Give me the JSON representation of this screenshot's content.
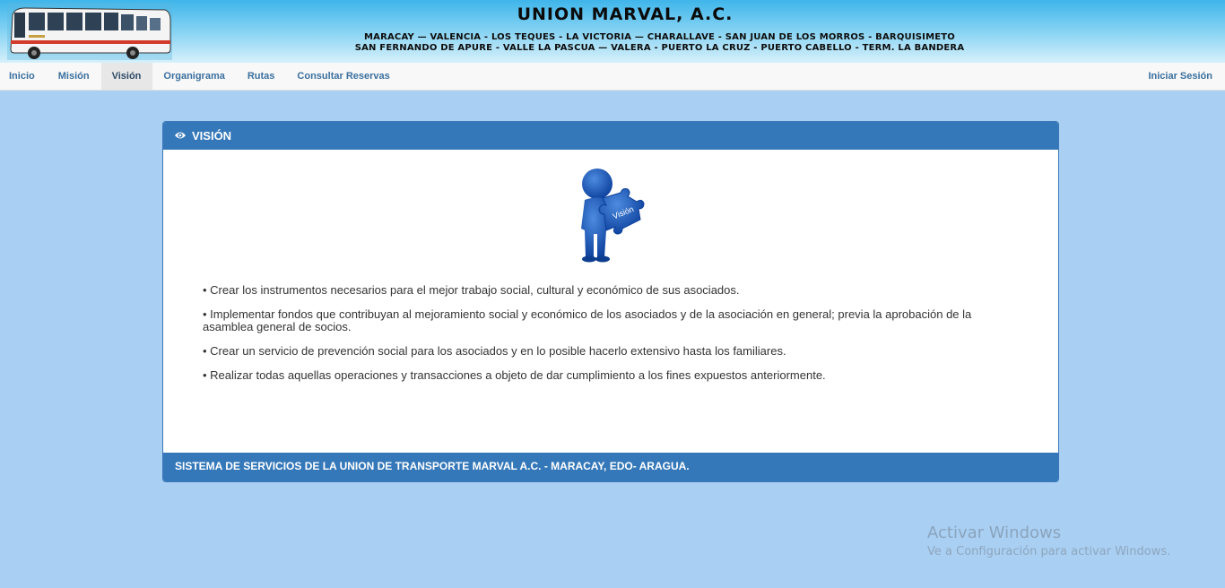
{
  "banner": {
    "title": "UNION MARVAL, A.C.",
    "routes_line1": "MARACAY — VALENCIA - LOS TEQUES - LA VICTORIA — CHARALLAVE - SAN JUAN DE LOS MORROS - BARQUISIMETO",
    "routes_line2": "SAN FERNANDO DE APURE - VALLE  LA PASCUA — VALERA - PUERTO LA CRUZ - PUERTO CABELLO - TERM. LA BANDERA",
    "bus_image": "bus-illustration"
  },
  "nav": {
    "items": [
      {
        "label": "Inicio"
      },
      {
        "label": "Misión"
      },
      {
        "label": "Visión"
      },
      {
        "label": "Organigrama"
      },
      {
        "label": "Rutas"
      },
      {
        "label": "Consultar Reservas"
      }
    ],
    "active": "Visión",
    "login_label": "Iniciar Sesión"
  },
  "panel": {
    "heading_icon": "eye-icon",
    "heading": "VISIÓN",
    "illustration_icon": "puzzle-person-icon",
    "illustration_text": "Visión",
    "items": [
      "• Crear los instrumentos necesarios para el mejor trabajo social, cultural y económico de sus asociados.",
      "• Implementar fondos que contribuyan al mejoramiento social y económico de los asociados y de la asociación en general; previa la aprobación de la asamblea general de socios.",
      "• Crear un servicio de prevención social para los asociados y en lo posible hacerlo extensivo hasta los familiares.",
      "• Realizar todas aquellas operaciones y transacciones a objeto de dar cumplimiento a los fines expuestos anteriormente."
    ],
    "footer": "SISTEMA DE SERVICIOS DE LA UNION DE TRANSPORTE MARVAL A.C. - MARACAY, EDO- ARAGUA."
  },
  "watermark": {
    "title": "Activar Windows",
    "subtitle": "Ve a Configuración para activar Windows."
  },
  "colors": {
    "page_bg": "#a9cff3",
    "panel_header": "#3578b9",
    "nav_link": "#3a6f9e"
  }
}
